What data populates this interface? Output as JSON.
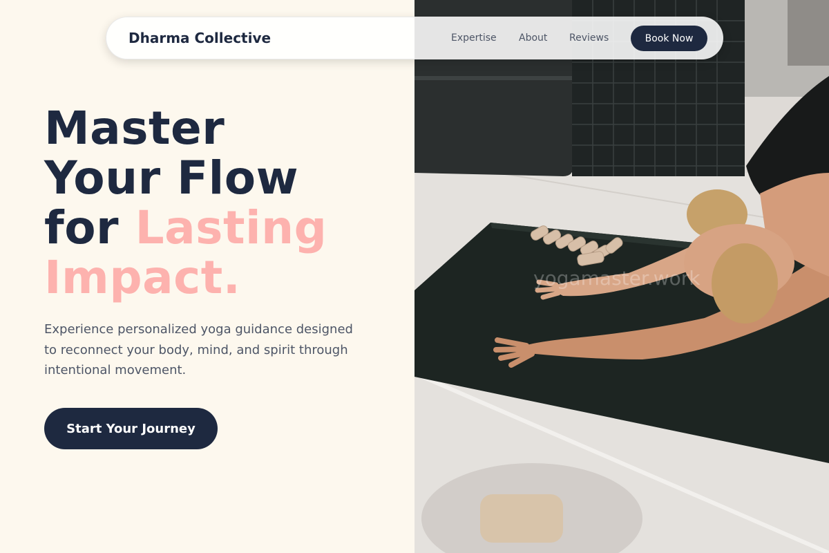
{
  "nav": {
    "brand": "Dharma Collective",
    "links": [
      {
        "label": "Expertise"
      },
      {
        "label": "About"
      },
      {
        "label": "Reviews"
      }
    ],
    "cta_label": "Book Now"
  },
  "hero": {
    "title_line1": "Master",
    "title_line2": "Your Flow",
    "title_line3_plain": "for ",
    "title_line3_accent": "Lasting",
    "title_line4_accent": "Impact.",
    "subtitle": "Experience personalized yoga guidance designed to reconnect your body, mind, and spirit through intentional movement.",
    "cta_label": "Start Your Journey"
  },
  "photo": {
    "watermark": "yogamaster.work",
    "subject": "woman in child's pose stretch on a black yoga mat"
  },
  "colors": {
    "cream_bg": "#fdf8ee",
    "navy": "#1e2940",
    "accent_pink": "#fdb2ae",
    "body_text": "#4d5566"
  }
}
